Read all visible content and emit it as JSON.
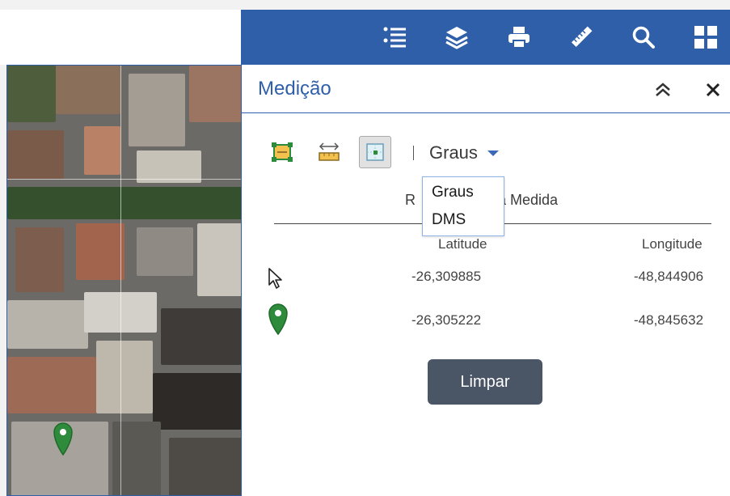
{
  "toolbar": {
    "tools": [
      {
        "name": "legend-list-icon"
      },
      {
        "name": "layers-icon"
      },
      {
        "name": "print-icon"
      },
      {
        "name": "ruler-icon",
        "active": true
      },
      {
        "name": "search-icon"
      },
      {
        "name": "widgets-grid-icon"
      }
    ],
    "bg_color": "#2f5fa8"
  },
  "panel": {
    "title": "Medição",
    "accent_color": "#2f5fa8"
  },
  "measure_tools": {
    "area_tool": "area-measure-icon",
    "distance_tool": "distance-measure-icon",
    "location_tool": "location-measure-icon",
    "selected": "location-measure-icon"
  },
  "unit_select": {
    "value": "Graus",
    "options": [
      "Graus",
      "DMS"
    ]
  },
  "result": {
    "label_left": "R",
    "label_right": "a Medida",
    "lat_header": "Latitude",
    "lon_header": "Longitude",
    "rows": [
      {
        "icon": "cursor-arrow-icon",
        "lat": "-26,309885",
        "lon": "-48,844906"
      },
      {
        "icon": "map-pin-icon",
        "lat": "-26,305222",
        "lon": "-48,845632"
      }
    ]
  },
  "clear_button": "Limpar",
  "colors": {
    "pin_green": "#2e8b3c",
    "button_bg": "#4a5566"
  }
}
